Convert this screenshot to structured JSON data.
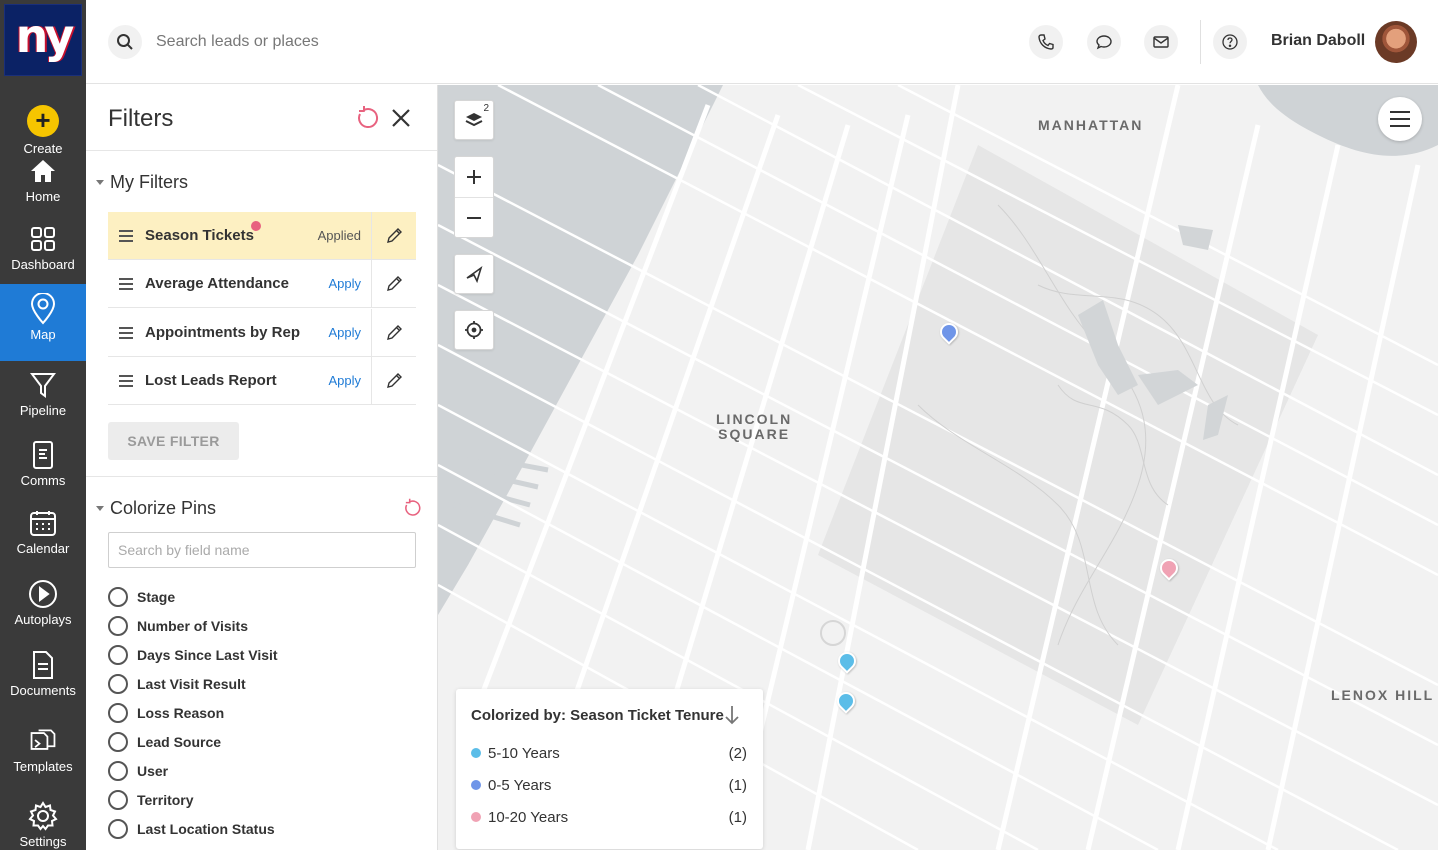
{
  "nav": {
    "logo_text": "ny",
    "items": [
      {
        "label": "Create"
      },
      {
        "label": "Home"
      },
      {
        "label": "Dashboard"
      },
      {
        "label": "Map"
      },
      {
        "label": "Pipeline"
      },
      {
        "label": "Comms"
      },
      {
        "label": "Calendar"
      },
      {
        "label": "Autoplays"
      },
      {
        "label": "Documents"
      },
      {
        "label": "Templates"
      },
      {
        "label": "Settings"
      }
    ],
    "active": "Map",
    "active_color": "#1f7bd6",
    "create_color": "#f6c500"
  },
  "topbar": {
    "search_placeholder": "Search leads or places",
    "icons": [
      "phone-icon",
      "chat-icon",
      "mail-icon",
      "help-icon"
    ],
    "user_name": "Brian Daboll"
  },
  "filters": {
    "title": "Filters",
    "my_filters": {
      "heading": "My Filters",
      "rows": [
        {
          "name": "Season Tickets",
          "action": "Applied",
          "applied": true,
          "has_dot": true
        },
        {
          "name": "Average Attendance",
          "action": "Apply",
          "applied": false,
          "has_dot": false
        },
        {
          "name": "Appointments by Rep",
          "action": "Apply",
          "applied": false,
          "has_dot": false
        },
        {
          "name": "Lost Leads Report",
          "action": "Apply",
          "applied": false,
          "has_dot": false
        }
      ],
      "save_label": "SAVE FILTER"
    },
    "colorize": {
      "heading": "Colorize Pins",
      "search_placeholder": "Search by field name",
      "fields": [
        "Stage",
        "Number of Visits",
        "Days Since Last Visit",
        "Last Visit Result",
        "Loss Reason",
        "Lead Source",
        "User",
        "Territory",
        "Last Location Status"
      ]
    }
  },
  "map": {
    "layers_count": "2",
    "labels": {
      "manhattan": "MANHATTAN",
      "lincoln": "LINCOLN\nSQUARE",
      "lenox": "LENOX HILL"
    },
    "legend": {
      "title": "Colorized by: Season Ticket Tenure",
      "items": [
        {
          "label": "5-10 Years",
          "count": "(2)",
          "color": "#5bbde8"
        },
        {
          "label": "0-5 Years",
          "count": "(1)",
          "color": "#6f95e8"
        },
        {
          "label": "10-20 Years",
          "count": "(1)",
          "color": "#f0a2b4"
        }
      ]
    }
  }
}
